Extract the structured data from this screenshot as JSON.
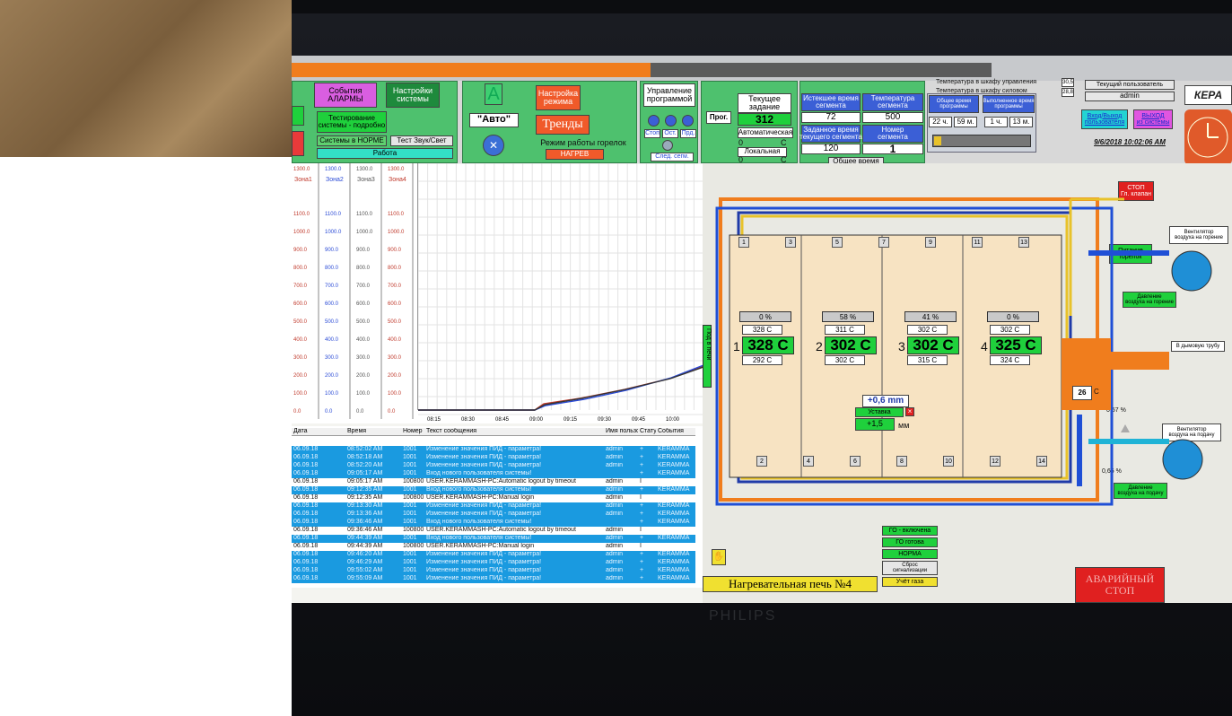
{
  "toolbar": {
    "events_alarms": "События\nАЛАРМЫ",
    "system_settings": "Настройки\nсистемы",
    "system_testing": "Тестирование\nсистемы - подробно",
    "systems_normal": "Системы в НОРМЕ",
    "sound_light_test": "Тест Звук/Свет",
    "work_status": "Работа",
    "mode_letter": "A",
    "auto_label": "\"Авто\"",
    "mode_settings": "Настройка\nрежима",
    "trends": "Тренды",
    "burner_mode_title": "Режим работы горелок",
    "burner_mode_value": "НАГРЕВ",
    "program_control_title": "Управление\nпрограммой",
    "prog_stop": "Стоп",
    "prog_pause": "Ост.",
    "prog_next": "Прд.",
    "next_segment": "След. сегм.",
    "prog_label": "Прог.",
    "current_setpoint_title": "Текущее\nзадание",
    "current_setpoint_value": "312",
    "automatic": "Автоматическая",
    "auto_value": "0",
    "auto_unit": "С",
    "local": "Локальная",
    "local_value": "0",
    "local_unit": "С",
    "elapsed_title": "Истекшее время\nсегмента",
    "elapsed_value": "72",
    "segment_temp_title": "Температура\nсегмента",
    "segment_temp_value": "500",
    "set_time_title": "Заданное время\nтекущего сегмента",
    "set_time_value": "120",
    "segment_no_title": "Номер\nсегмента",
    "segment_no_value": "1",
    "total_time_btn": "Общее время",
    "prog_total_title": "Общее время\nпрограммы",
    "prog_total_h": "22 ч.",
    "prog_total_m": "59 м.",
    "prog_done_title": "Выполненное время\nпрограммы",
    "prog_done_h": "1 ч.",
    "prog_done_m": "13 м.",
    "temp_control_cabinet": "Температура в шкафу управления",
    "temp_control_value": "30,5",
    "temp_power_cabinet": "Температура в шкафу силовом",
    "temp_power_value": "28,8",
    "current_user_title": "Текущий пользователь",
    "current_user": "admin",
    "login_logout": "Вход/Выход\nпользователя",
    "exit_system": "ВЫХОД\nиз системы",
    "datetime": "9/6/2018 10:02:06 AM",
    "logo": "КЕРА"
  },
  "chart": {
    "zones": [
      "Зона1",
      "Зона2",
      "Зона3",
      "Зона4"
    ],
    "scale_ticks": [
      "1300.0",
      "1100.0",
      "1000.0",
      "900.0",
      "800.0",
      "700.0",
      "600.0",
      "500.0",
      "400.0",
      "300.0",
      "200.0",
      "100.0",
      "0.0"
    ],
    "time_ticks": [
      "08:15",
      "08:30",
      "08:45",
      "09:00",
      "09:15",
      "09:30",
      "09:45",
      "10:00"
    ]
  },
  "events": {
    "headers": [
      "Дата",
      "Время",
      "Номер",
      "Текст сообщения",
      "Имя пользо",
      "Статус",
      "События"
    ],
    "rows": [
      {
        "date": "06.09.18",
        "time": "08:52:02 AM",
        "num": "1001",
        "text": "Изменение значения ПИД - параметра!",
        "user": "admin",
        "status": "+",
        "ev": "KERAMMA",
        "hl": true
      },
      {
        "date": "06.09.18",
        "time": "08:52:18 AM",
        "num": "1001",
        "text": "Изменение значения ПИД - параметра!",
        "user": "admin",
        "status": "+",
        "ev": "KERAMMA",
        "hl": true
      },
      {
        "date": "06.09.18",
        "time": "08:52:20 AM",
        "num": "1001",
        "text": "Изменение значения ПИД - параметра!",
        "user": "admin",
        "status": "+",
        "ev": "KERAMMA",
        "hl": true
      },
      {
        "date": "06.09.18",
        "time": "09:05:17 AM",
        "num": "1001",
        "text": "Вход нового пользователя системы!",
        "user": "",
        "status": "+",
        "ev": "KERAMMA",
        "hl": true
      },
      {
        "date": "06.09.18",
        "time": "09:05:17 AM",
        "num": "100800",
        "text": "USER.KERAMMASH-PC:Automatic logout by timeout",
        "user": "admin",
        "status": "I",
        "ev": "",
        "hl": false
      },
      {
        "date": "06.09.18",
        "time": "09:12:35 AM",
        "num": "1001",
        "text": "Вход нового пользователя системы!",
        "user": "admin",
        "status": "+",
        "ev": "KERAMMA",
        "hl": true
      },
      {
        "date": "06.09.18",
        "time": "09:12:35 AM",
        "num": "100800",
        "text": "USER.KERAMMASH-PC:Manual login",
        "user": "admin",
        "status": "I",
        "ev": "",
        "hl": false
      },
      {
        "date": "06.09.18",
        "time": "09:13:30 AM",
        "num": "1001",
        "text": "Изменение значения ПИД - параметра!",
        "user": "admin",
        "status": "+",
        "ev": "KERAMMA",
        "hl": true
      },
      {
        "date": "06.09.18",
        "time": "09:13:36 AM",
        "num": "1001",
        "text": "Изменение значения ПИД - параметра!",
        "user": "admin",
        "status": "+",
        "ev": "KERAMMA",
        "hl": true
      },
      {
        "date": "06.09.18",
        "time": "09:36:46 AM",
        "num": "1001",
        "text": "Вход нового пользователя системы!",
        "user": "",
        "status": "+",
        "ev": "KERAMMA",
        "hl": true
      },
      {
        "date": "06.09.18",
        "time": "09:36:46 AM",
        "num": "100800",
        "text": "USER.KERAMMASH-PC:Automatic logout by timeout",
        "user": "admin",
        "status": "I",
        "ev": "",
        "hl": false
      },
      {
        "date": "06.09.18",
        "time": "09:44:39 AM",
        "num": "1001",
        "text": "Вход нового пользователя системы!",
        "user": "admin",
        "status": "+",
        "ev": "KERAMMA",
        "hl": true
      },
      {
        "date": "06.09.18",
        "time": "09:44:39 AM",
        "num": "100800",
        "text": "USER.KERAMMASH-PC:Manual login",
        "user": "admin",
        "status": "I",
        "ev": "",
        "hl": false
      },
      {
        "date": "06.09.18",
        "time": "09:46:20 AM",
        "num": "1001",
        "text": "Изменение значения ПИД - параметра!",
        "user": "admin",
        "status": "+",
        "ev": "KERAMMA",
        "hl": true
      },
      {
        "date": "06.09.18",
        "time": "09:46:29 AM",
        "num": "1001",
        "text": "Изменение значения ПИД - параметра!",
        "user": "admin",
        "status": "+",
        "ev": "KERAMMA",
        "hl": true
      },
      {
        "date": "06.09.18",
        "time": "09:55:02 AM",
        "num": "1001",
        "text": "Изменение значения ПИД - параметра!",
        "user": "admin",
        "status": "+",
        "ev": "KERAMMA",
        "hl": true
      },
      {
        "date": "06.09.18",
        "time": "09:55:09 AM",
        "num": "1001",
        "text": "Изменение значения ПИД - параметра!",
        "user": "admin",
        "status": "+",
        "ev": "KERAMMA",
        "hl": true
      }
    ]
  },
  "kiln": {
    "stop_valve": "СТОП\nГл. клапан",
    "fan_burn": "Вентилятор\nвоздуха на горение",
    "gas_supply": "Питание\nгорелок",
    "air_pressure": "Давление\nвоздуха на горение",
    "to_chimney": "В дымовую трубу",
    "fan_supply": "Вентилятор\nвоздуха на подачу",
    "air_pressure_supply": "Давление\nвоздуха на подачу",
    "pct_top": "0,57 %",
    "pct_bottom": "0,66 %",
    "chimney_temp": "26",
    "chimney_unit": "C",
    "vert_button": "Под в печи",
    "pressure_value": "+0,6 mm",
    "setpoint_label": "Уставка",
    "setpoint_value": "+1,5",
    "setpoint_unit": "мм",
    "zones": [
      {
        "no": "1",
        "pct": "0 %",
        "top": "328 C",
        "main": "328 C",
        "bottom": "292 C"
      },
      {
        "no": "2",
        "pct": "58 %",
        "top": "311 C",
        "main": "302 C",
        "bottom": "302 C"
      },
      {
        "no": "3",
        "pct": "41 %",
        "top": "302 C",
        "main": "302 C",
        "bottom": "315 C"
      },
      {
        "no": "4",
        "pct": "0 %",
        "top": "302 C",
        "main": "325 C",
        "bottom": "324 C"
      }
    ],
    "holes_top": [
      "1",
      "3",
      "5",
      "7",
      "9",
      "11",
      "13"
    ],
    "holes_bottom": [
      "2",
      "4",
      "6",
      "8",
      "10",
      "12",
      "14"
    ],
    "status_on": "ГО - включена",
    "status_ready": "ГО готова",
    "status_norm": "НОРМА",
    "status_reset": "Сброс\nсигнализации",
    "status_event": "Учёт газа",
    "furnace_name": "Нагревательная печь №4",
    "emergency_stop": "АВАРИЙНЫЙ\nСТОП"
  },
  "monitor_brand": "PHILIPS"
}
